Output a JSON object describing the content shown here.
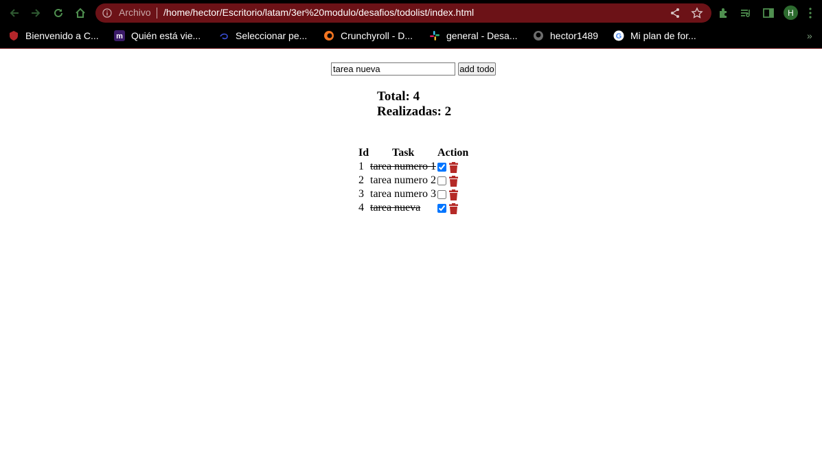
{
  "browser": {
    "omnibox_label": "Archivo",
    "url": "/home/hector/Escritorio/latam/3er%20modulo/desafios/todolist/index.html",
    "avatar_letter": "H",
    "bookmarks": [
      {
        "label": "Bienvenido a C...",
        "icon": "red-shield-icon"
      },
      {
        "label": "Quién está vie...",
        "icon": "m-logo-icon"
      },
      {
        "label": "Seleccionar pe...",
        "icon": "disney-icon"
      },
      {
        "label": "Crunchyroll - D...",
        "icon": "crunchyroll-icon"
      },
      {
        "label": "general - Desa...",
        "icon": "slack-icon"
      },
      {
        "label": "hector1489",
        "icon": "github-icon"
      },
      {
        "label": "Mi plan de for...",
        "icon": "google-icon"
      }
    ],
    "bookmarks_more": "»"
  },
  "app": {
    "input_value": "tarea nueva",
    "add_button_label": "add todo",
    "total_text": "Total: 4",
    "done_text": "Realizadas: 2",
    "headers": {
      "id": "Id",
      "task": "Task",
      "action": "Action"
    },
    "todos": [
      {
        "id": "1",
        "task": "tarea numero 1",
        "done": true
      },
      {
        "id": "2",
        "task": "tarea numero 2",
        "done": false
      },
      {
        "id": "3",
        "task": "tarea numero 3",
        "done": false
      },
      {
        "id": "4",
        "task": "tarea nueva",
        "done": true
      }
    ],
    "trash_color": "#b52a27"
  }
}
